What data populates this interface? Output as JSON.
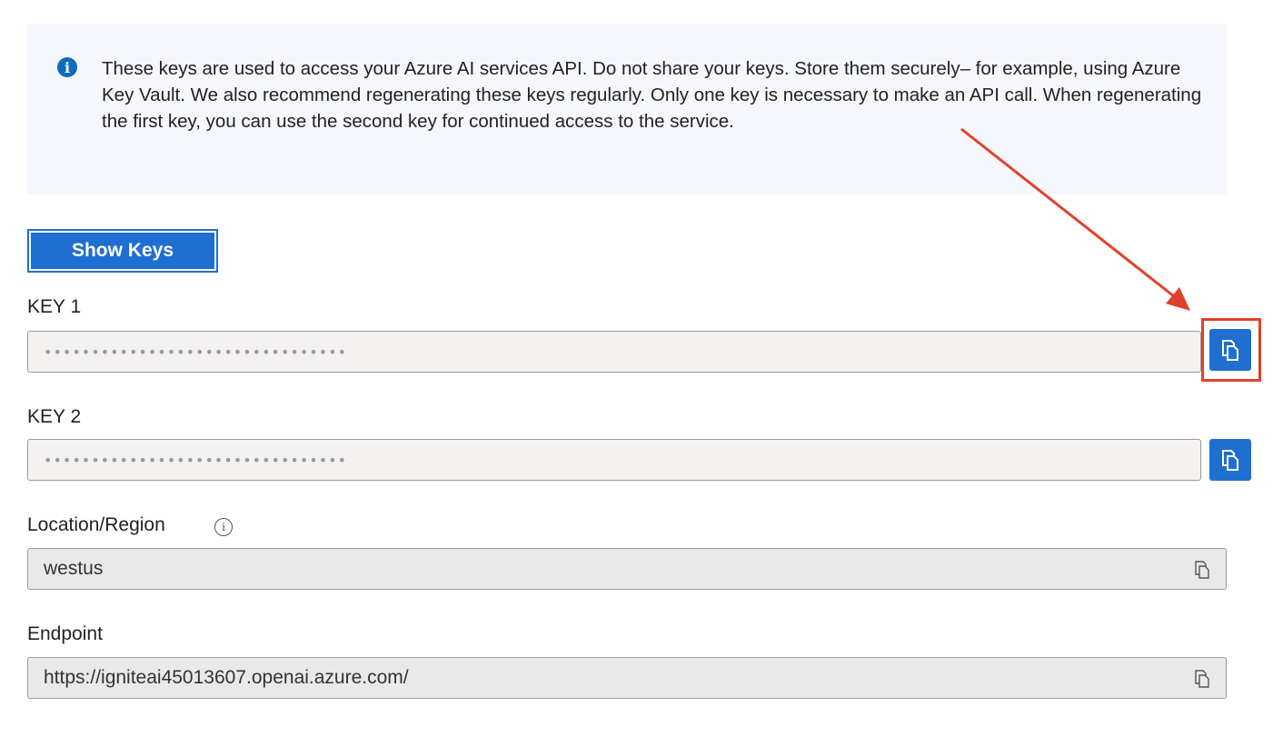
{
  "info": {
    "icon": "info-icon",
    "text": "These keys are used to access your Azure AI services API. Do not share your keys. Store them securely– for example, using Azure Key Vault. We also recommend regenerating these keys regularly. Only one key is necessary to make an API call. When regenerating the first key, you can use the second key for continued access to the service."
  },
  "show_keys_label": "Show Keys",
  "key1": {
    "label": "KEY 1",
    "value": "••••••••••••••••••••••••••••••••"
  },
  "key2": {
    "label": "KEY 2",
    "value": "••••••••••••••••••••••••••••••••"
  },
  "location": {
    "label": "Location/Region",
    "info_glyph": "i",
    "value": "westus"
  },
  "endpoint": {
    "label": "Endpoint",
    "value": "https://igniteai45013607.openai.azure.com/"
  },
  "colors": {
    "accent": "#1f6fd0",
    "annotation": "#e0412a",
    "banner_bg": "#f5f7fc"
  }
}
